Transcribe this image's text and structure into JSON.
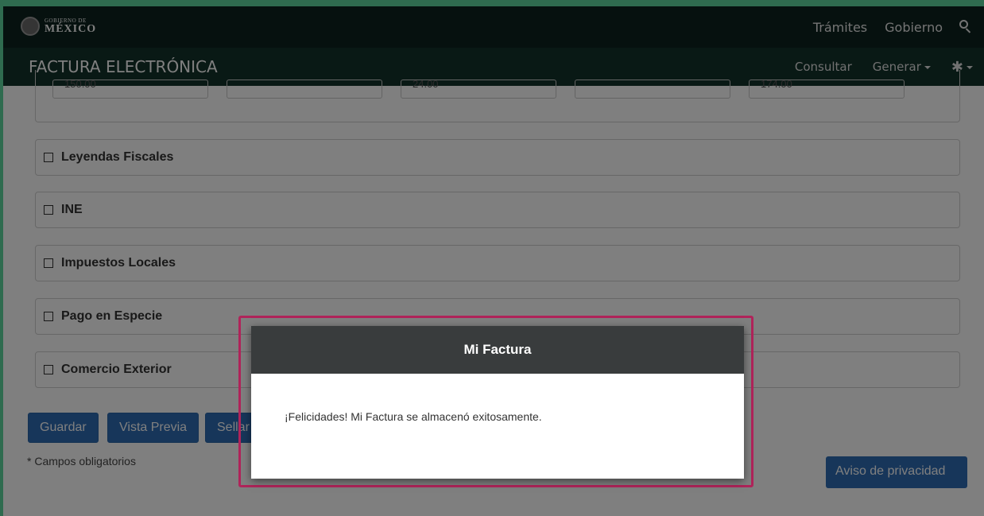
{
  "header": {
    "logo_small": "GOBIERNO DE",
    "logo_big": "MÉXICO",
    "nav": [
      "Trámites",
      "Gobierno"
    ]
  },
  "subheader": {
    "title": "FACTURA ELECTRÓNICA",
    "nav_consultar": "Consultar",
    "nav_generar": "Generar"
  },
  "amounts": [
    "150.00",
    "",
    "24.00",
    "",
    "174.00"
  ],
  "sections": [
    {
      "label": "Leyendas Fiscales"
    },
    {
      "label": "INE"
    },
    {
      "label": "Impuestos Locales"
    },
    {
      "label": "Pago en Especie"
    },
    {
      "label": "Comercio Exterior"
    }
  ],
  "buttons": {
    "guardar": "Guardar",
    "vista_previa": "Vista Previa",
    "sellar": "Sellar"
  },
  "required_note": "* Campos obligatorios",
  "privacy_button": "Aviso de privacidad",
  "dialog": {
    "title": "Mi Factura",
    "message": "¡Felicidades! Mi Factura se almacenó exitosamente."
  },
  "colors": {
    "topbar": "#0c231e",
    "subbar": "#13322b",
    "button": "#2e6db4",
    "highlight": "#b0245a",
    "dialog_header": "#393c3d"
  }
}
